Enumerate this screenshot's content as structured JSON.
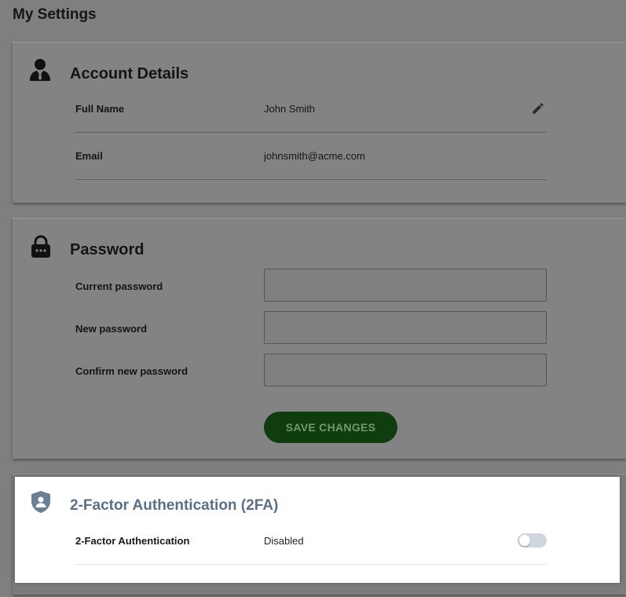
{
  "page": {
    "title": "My Settings"
  },
  "account": {
    "title": "Account Details",
    "icon": "user-icon",
    "full_name_label": "Full Name",
    "full_name_value": "John Smith",
    "email_label": "Email",
    "email_value": "johnsmith@acme.com"
  },
  "password": {
    "title": "Password",
    "icon": "lock-icon",
    "current_label": "Current password",
    "new_label": "New password",
    "confirm_label": "Confirm new password",
    "current_value": "",
    "new_value": "",
    "confirm_value": "",
    "save_label": "SAVE CHANGES"
  },
  "tfa": {
    "title": "2-Factor Authentication (2FA)",
    "icon": "shield-user-icon",
    "label": "2-Factor Authentication",
    "status": "Disabled",
    "enabled": false
  },
  "colors": {
    "accent_green": "#0f3d0f",
    "tfa_title": "#5b6f85",
    "toggle_off": "#cfd6e0"
  }
}
